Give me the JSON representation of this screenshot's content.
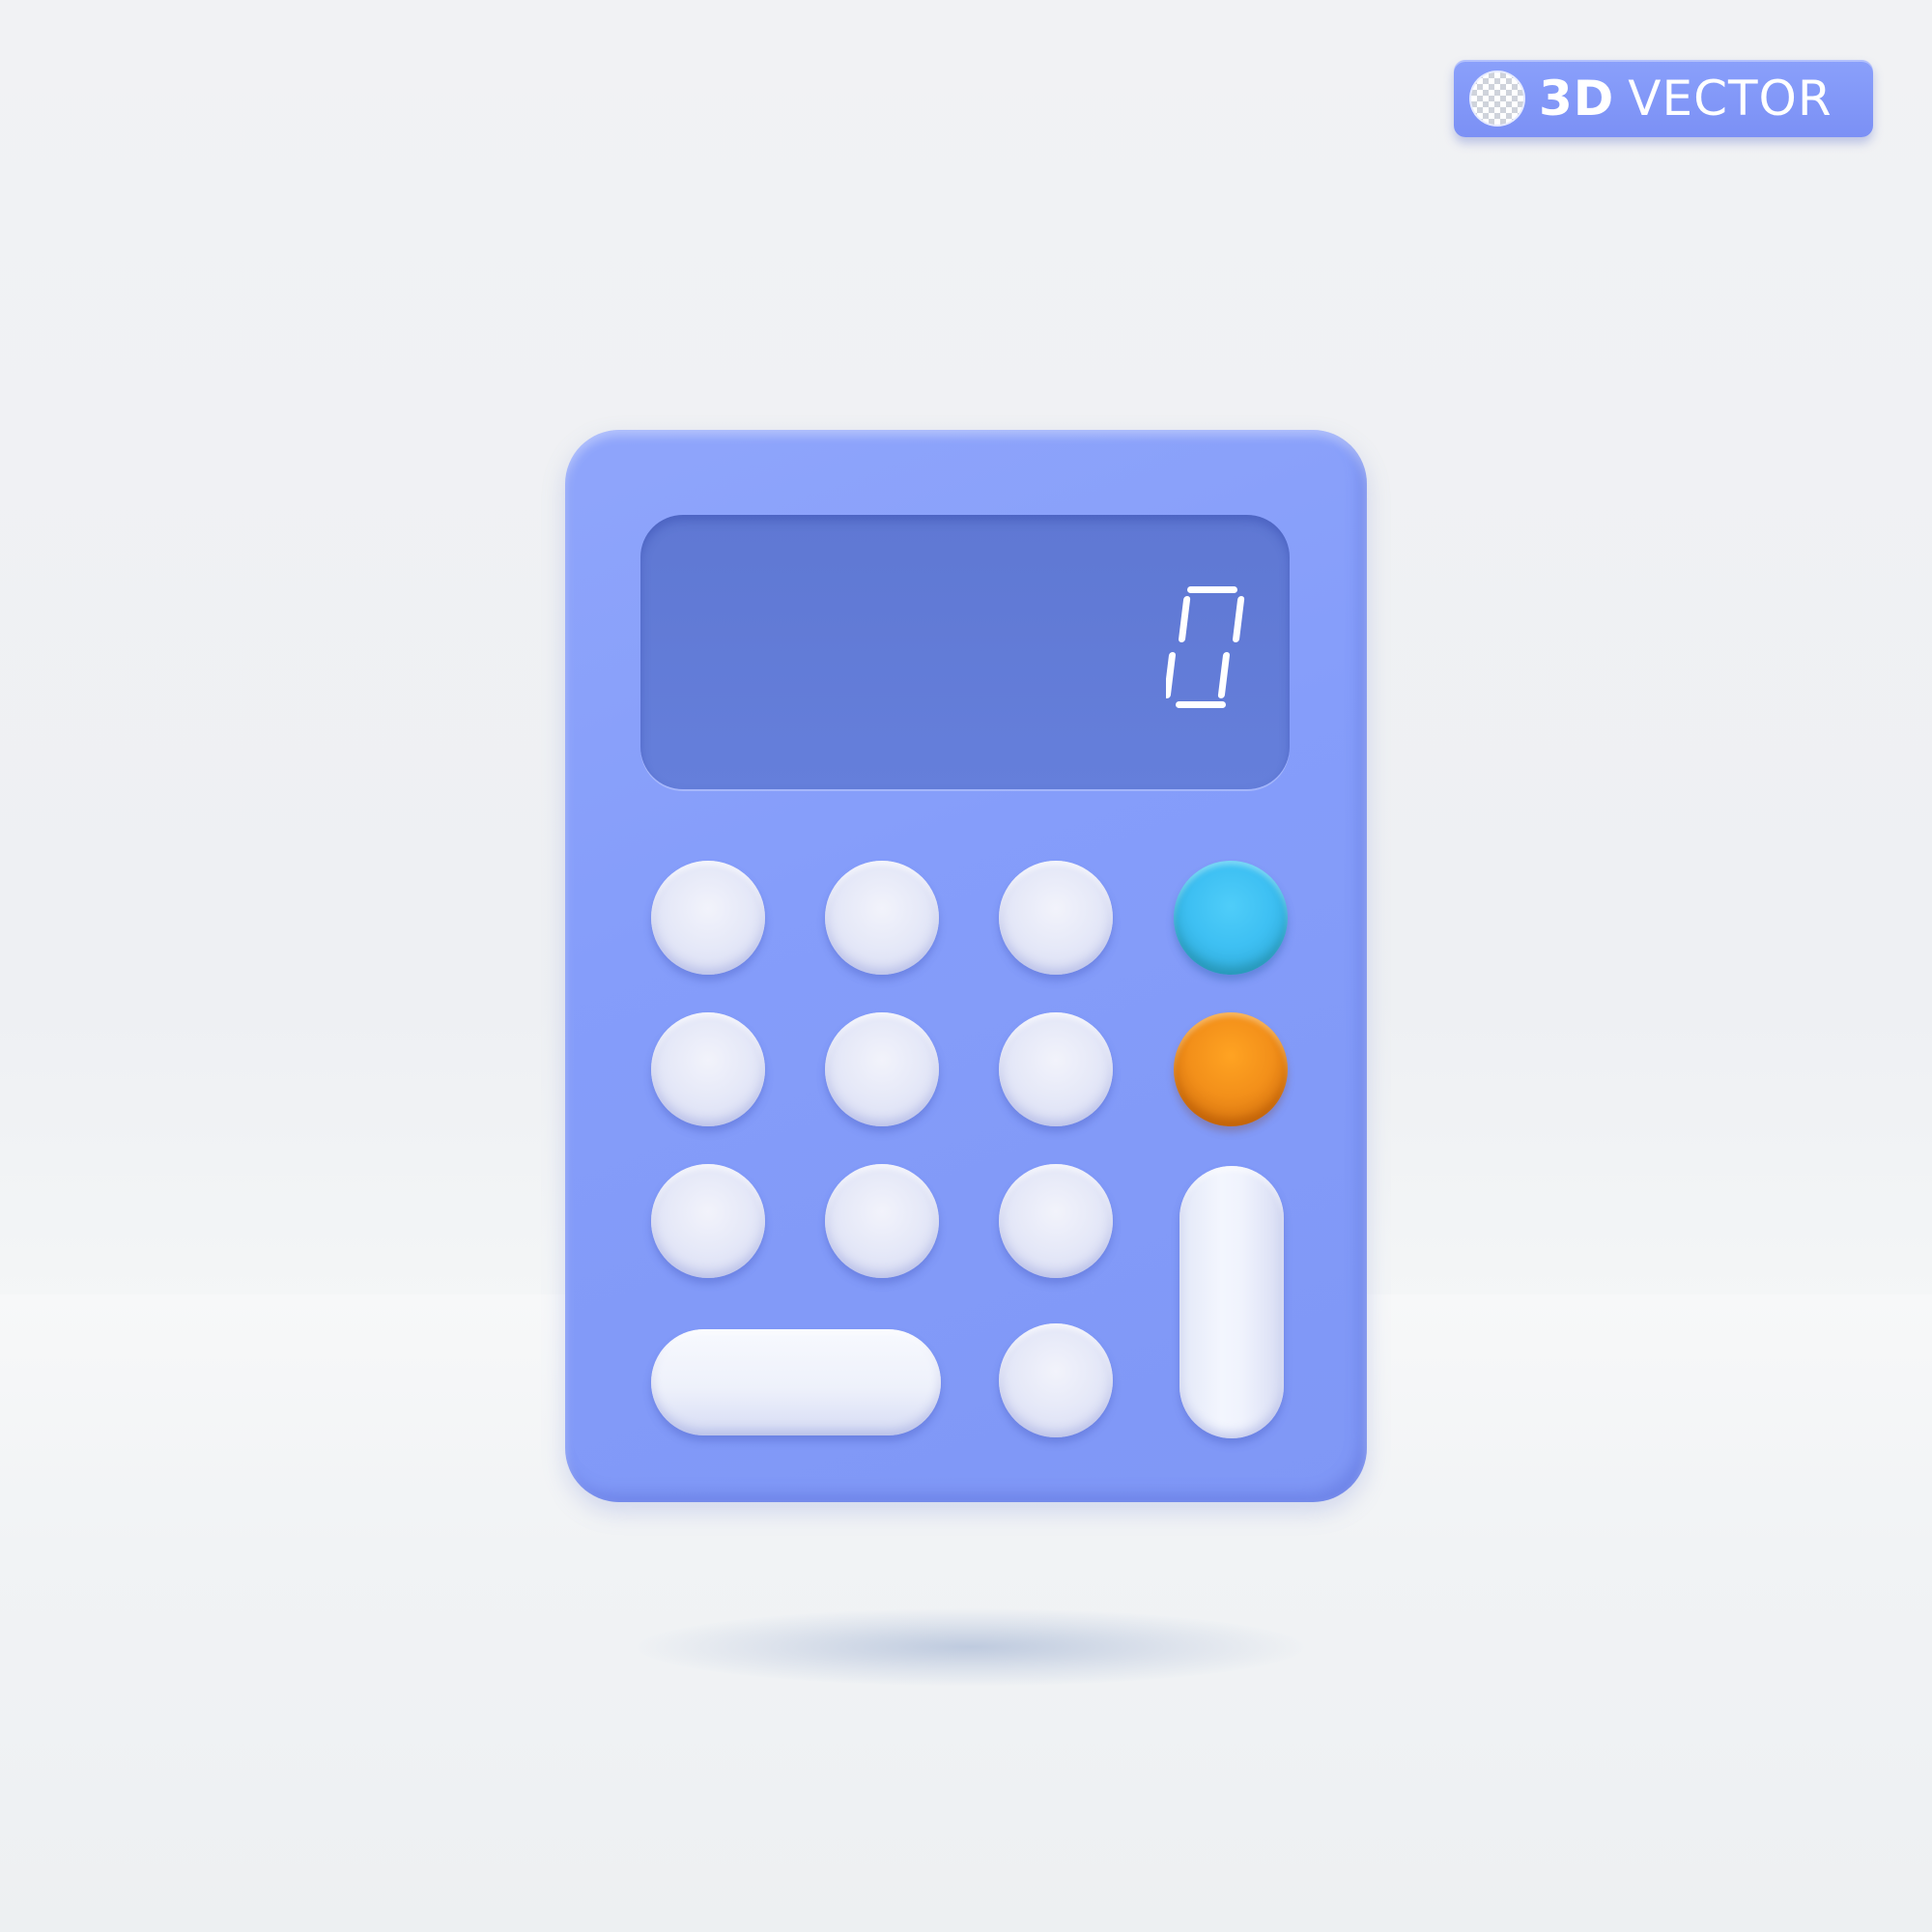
{
  "badge": {
    "bold_text": "3D",
    "light_text": "VECTOR",
    "icon": "transparency-checker-icon"
  },
  "calculator": {
    "display_value": "0",
    "display_style": "seven-segment",
    "colors": {
      "body": "#859dfa",
      "screen": "#627bd7",
      "key": "#e6e9f8",
      "key_cyan": "#3ec0f3",
      "key_orange": "#f3901a",
      "digit": "#ffffff"
    },
    "keys": [
      {
        "name": "key-r1-c1",
        "color": "white"
      },
      {
        "name": "key-r1-c2",
        "color": "white"
      },
      {
        "name": "key-r1-c3",
        "color": "white"
      },
      {
        "name": "key-r1-c4",
        "color": "cyan"
      },
      {
        "name": "key-r2-c1",
        "color": "white"
      },
      {
        "name": "key-r2-c2",
        "color": "white"
      },
      {
        "name": "key-r2-c3",
        "color": "white"
      },
      {
        "name": "key-r2-c4",
        "color": "orange"
      },
      {
        "name": "key-r3-c1",
        "color": "white"
      },
      {
        "name": "key-r3-c2",
        "color": "white"
      },
      {
        "name": "key-r3-c3",
        "color": "white"
      },
      {
        "name": "key-tall-right",
        "color": "white"
      },
      {
        "name": "key-wide-left",
        "color": "white"
      },
      {
        "name": "key-r4-c3",
        "color": "white"
      }
    ]
  }
}
